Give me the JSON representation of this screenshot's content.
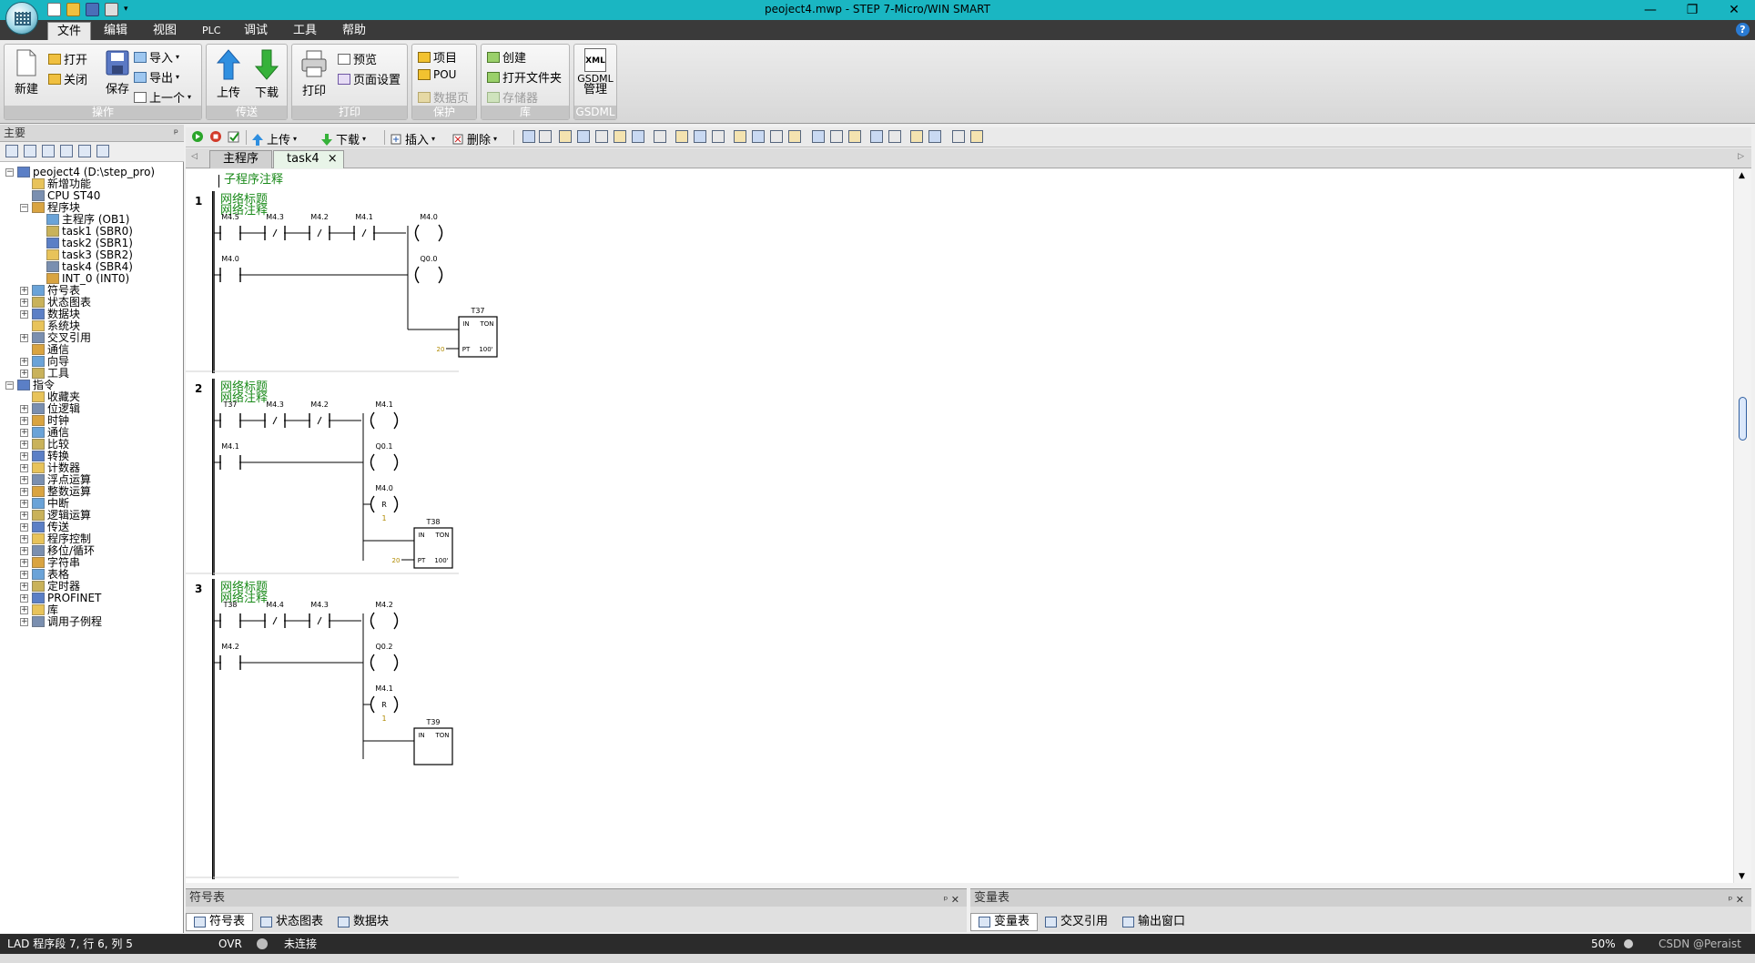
{
  "window": {
    "title": "peoject4.mwp - STEP 7-Micro/WIN SMART",
    "controls": [
      "—",
      "❐",
      "✕"
    ]
  },
  "menu": {
    "tabs": [
      "文件",
      "编辑",
      "视图",
      "PLC",
      "调试",
      "工具",
      "帮助"
    ],
    "active_tab": "文件",
    "help_label": "?"
  },
  "ribbon": {
    "groups": {
      "operate": {
        "label": "操作",
        "new": "新建",
        "open": "打开",
        "close": "关闭",
        "save": "保存",
        "import": "导入",
        "export": "导出",
        "previous": "上一个"
      },
      "transfer": {
        "label": "传送",
        "upload": "上传",
        "download": "下载"
      },
      "print": {
        "label": "打印",
        "print": "打印",
        "preview": "预览",
        "page_setup": "页面设置"
      },
      "protect": {
        "label": "保护",
        "project": "项目",
        "pou": "POU",
        "data_page": "数据页"
      },
      "library": {
        "label": "库",
        "create": "创建",
        "open_folder": "打开文件夹",
        "memory": "存储器"
      },
      "gsdml": {
        "label": "GSDML",
        "xml": "XML",
        "manage_line1": "GSDML",
        "manage_line2": "管理"
      }
    }
  },
  "left_panel": {
    "title": "主要",
    "pin": "ᵖ",
    "tree": [
      {
        "label": "peoject4 (D:\\step_pro)",
        "level": 0,
        "exp": "−"
      },
      {
        "label": "新增功能",
        "level": 1,
        "exp": ""
      },
      {
        "label": "CPU ST40",
        "level": 1,
        "exp": ""
      },
      {
        "label": "程序块",
        "level": 1,
        "exp": "−"
      },
      {
        "label": "主程序 (OB1)",
        "level": 2,
        "exp": ""
      },
      {
        "label": "task1 (SBR0)",
        "level": 2,
        "exp": ""
      },
      {
        "label": "task2 (SBR1)",
        "level": 2,
        "exp": ""
      },
      {
        "label": "task3 (SBR2)",
        "level": 2,
        "exp": ""
      },
      {
        "label": "task4 (SBR4)",
        "level": 2,
        "exp": ""
      },
      {
        "label": "INT_0 (INT0)",
        "level": 2,
        "exp": ""
      },
      {
        "label": "符号表",
        "level": 1,
        "exp": "+"
      },
      {
        "label": "状态图表",
        "level": 1,
        "exp": "+"
      },
      {
        "label": "数据块",
        "level": 1,
        "exp": "+"
      },
      {
        "label": "系统块",
        "level": 1,
        "exp": ""
      },
      {
        "label": "交叉引用",
        "level": 1,
        "exp": "+"
      },
      {
        "label": "通信",
        "level": 1,
        "exp": ""
      },
      {
        "label": "向导",
        "level": 1,
        "exp": "+"
      },
      {
        "label": "工具",
        "level": 1,
        "exp": "+"
      },
      {
        "label": "指令",
        "level": 0,
        "exp": "−"
      },
      {
        "label": "收藏夹",
        "level": 1,
        "exp": ""
      },
      {
        "label": "位逻辑",
        "level": 1,
        "exp": "+"
      },
      {
        "label": "时钟",
        "level": 1,
        "exp": "+"
      },
      {
        "label": "通信",
        "level": 1,
        "exp": "+"
      },
      {
        "label": "比较",
        "level": 1,
        "exp": "+"
      },
      {
        "label": "转换",
        "level": 1,
        "exp": "+"
      },
      {
        "label": "计数器",
        "level": 1,
        "exp": "+"
      },
      {
        "label": "浮点运算",
        "level": 1,
        "exp": "+"
      },
      {
        "label": "整数运算",
        "level": 1,
        "exp": "+"
      },
      {
        "label": "中断",
        "level": 1,
        "exp": "+"
      },
      {
        "label": "逻辑运算",
        "level": 1,
        "exp": "+"
      },
      {
        "label": "传送",
        "level": 1,
        "exp": "+"
      },
      {
        "label": "程序控制",
        "level": 1,
        "exp": "+"
      },
      {
        "label": "移位/循环",
        "level": 1,
        "exp": "+"
      },
      {
        "label": "字符串",
        "level": 1,
        "exp": "+"
      },
      {
        "label": "表格",
        "level": 1,
        "exp": "+"
      },
      {
        "label": "定时器",
        "level": 1,
        "exp": "+"
      },
      {
        "label": "PROFINET",
        "level": 1,
        "exp": "+"
      },
      {
        "label": "库",
        "level": 1,
        "exp": "+"
      },
      {
        "label": "调用子例程",
        "level": 1,
        "exp": "+"
      }
    ]
  },
  "editor_toolbar": {
    "upload": "上传",
    "download": "下载",
    "insert": "插入",
    "delete": "删除"
  },
  "doc_tabs": {
    "main": "主程序",
    "task4": "task4",
    "close": "×"
  },
  "editor": {
    "subroutine_comment": "子程序注释",
    "networks": [
      {
        "number": "1",
        "title": "网络标题",
        "comment": "网络注释",
        "row1_contacts": [
          "M4.5",
          "M4.3",
          "M4.2",
          "M4.1"
        ],
        "row1_coil": "M4.0",
        "row2_contact": "M4.0",
        "coils": [
          "Q0.0"
        ],
        "timer": {
          "name": "T37",
          "in": "IN",
          "type": "TON",
          "pt": "PT",
          "base": "100'",
          "preset": "20"
        }
      },
      {
        "number": "2",
        "title": "网络标题",
        "comment": "网络注释",
        "row1_contacts": [
          "T37",
          "M4.3",
          "M4.2"
        ],
        "row1_coil": "M4.1",
        "row2_contact": "M4.1",
        "coils": [
          "Q0.1"
        ],
        "reset": {
          "bit": "M4.0",
          "letter": "R",
          "n": "1"
        },
        "timer": {
          "name": "T38",
          "in": "IN",
          "type": "TON",
          "pt": "PT",
          "base": "100'",
          "preset": "20"
        }
      },
      {
        "number": "3",
        "title": "网络标题",
        "comment": "网络注释",
        "row1_contacts": [
          "T38",
          "M4.4",
          "M4.3"
        ],
        "row1_coil": "M4.2",
        "row2_contact": "M4.2",
        "coils": [
          "Q0.2"
        ],
        "reset": {
          "bit": "M4.1",
          "letter": "R",
          "n": "1"
        },
        "timer": {
          "name": "T39",
          "in": "IN",
          "type": "TON"
        }
      }
    ]
  },
  "bottom_left": {
    "title": "符号表",
    "controls": "ᵖ ✕",
    "tabs": [
      "符号表",
      "状态图表",
      "数据块"
    ]
  },
  "bottom_right": {
    "title": "变量表",
    "controls": "ᵖ ✕",
    "tabs": [
      "变量表",
      "交叉引用",
      "输出窗口"
    ]
  },
  "status": {
    "position": "LAD 程序段 7, 行 6, 列 5",
    "mode": "OVR",
    "connection": "未连接",
    "zoom": "50%",
    "watermark": "CSDN @Peraist"
  },
  "colors": {
    "titlebar": "#1ab6c2",
    "menubar": "#3a3a3a",
    "comment_green": "#1a8a1a",
    "statusbar": "#2b2b2b"
  }
}
